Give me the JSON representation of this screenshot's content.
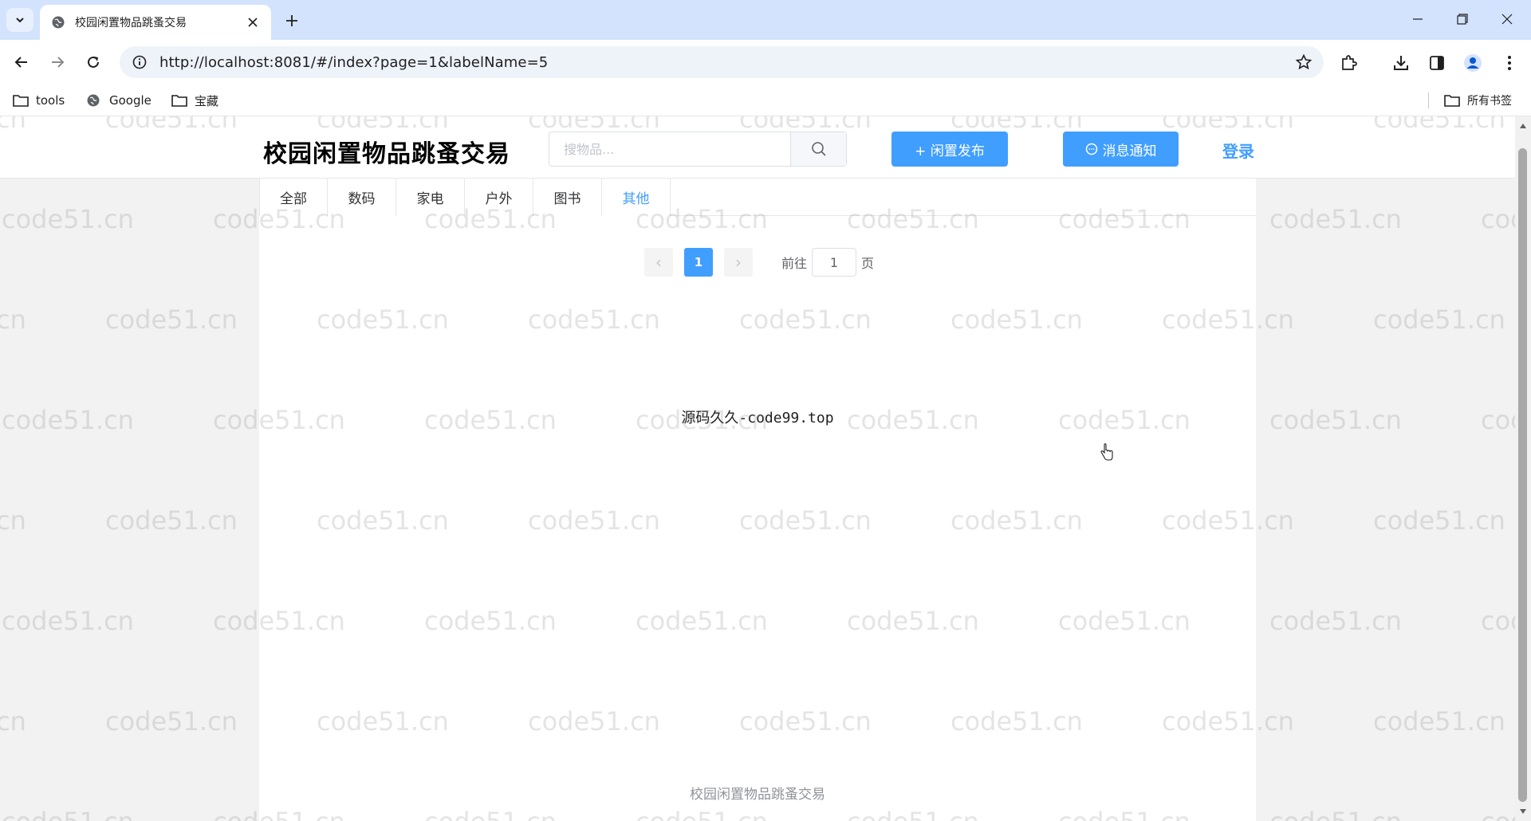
{
  "browser": {
    "tab_title": "校园闲置物品跳蚤交易",
    "url": "http://localhost:8081/#/index?page=1&labelName=5",
    "bookmarks": [
      "tools",
      "Google",
      "宝藏"
    ],
    "all_bookmarks_label": "所有书签"
  },
  "header": {
    "site_title": "校园闲置物品跳蚤交易",
    "search_placeholder": "搜物品...",
    "publish_button": "+ 闲置发布",
    "notify_button": "消息通知",
    "login_link": "登录"
  },
  "categories": [
    "全部",
    "数码",
    "家电",
    "户外",
    "图书",
    "其他"
  ],
  "active_category": "其他",
  "pagination": {
    "prev_symbol": "‹",
    "current_page": "1",
    "next_symbol": "›",
    "jump_label": "前往",
    "jump_value": "1",
    "page_unit": "页"
  },
  "center_text": "源码久久-code99.top",
  "footer": "校园闲置物品跳蚤交易",
  "watermark_text": "code51.cn",
  "colors": {
    "primary": "#409eff",
    "tab_strip": "#d3e3fd",
    "page_background": "#f2f2f2"
  },
  "icons": [
    "tab-list-icon",
    "globe-favicon-icon",
    "close-icon",
    "plus-icon",
    "minimize-icon",
    "restore-icon",
    "window-close-icon",
    "back-icon",
    "forward-icon",
    "reload-icon",
    "site-info-icon",
    "star-icon",
    "extensions-icon",
    "download-icon",
    "side-panel-icon",
    "profile-icon",
    "more-icon",
    "folder-icon",
    "search-icon",
    "chat-icon"
  ]
}
